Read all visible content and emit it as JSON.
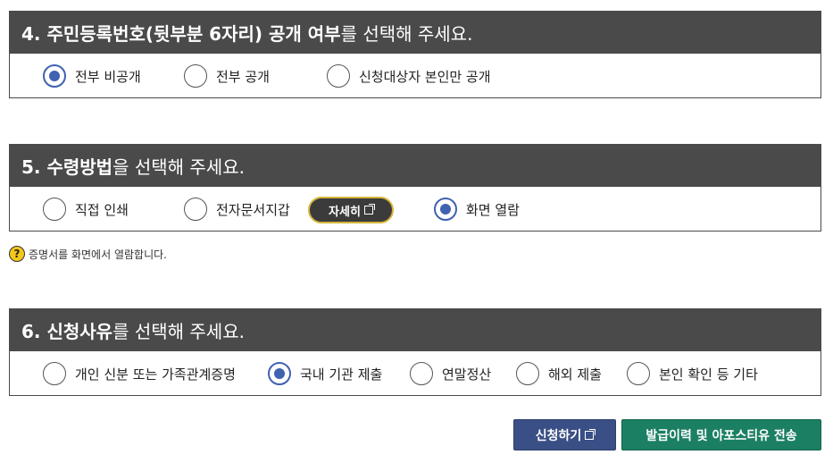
{
  "section4": {
    "title_strong": "4. 주민등록번호(뒷부분 6자리) 공개 여부",
    "title_rest": "를 선택해 주세요.",
    "options": [
      "전부 비공개",
      "전부 공개",
      "신청대상자 본인만 공개"
    ],
    "selected": "전부 비공개"
  },
  "section5": {
    "title_strong": "5. 수령방법",
    "title_rest": "을 선택해 주세요.",
    "options": [
      "직접 인쇄",
      "전자문서지갑",
      "화면 열람"
    ],
    "detail_button": "자세히",
    "selected": "화면 열람"
  },
  "note": {
    "icon": "?",
    "text": "증명서를 화면에서 열람합니다."
  },
  "section6": {
    "title_strong": "6. 신청사유",
    "title_rest": "를 선택해 주세요.",
    "options": [
      "개인 신분 또는 가족관계증명",
      "국내 기관 제출",
      "연말정산",
      "해외 제출",
      "본인 확인 등 기타"
    ],
    "selected": "국내 기관 제출"
  },
  "actions": {
    "apply": "신청하기",
    "history": "발급이력 및 아포스티유 전송"
  },
  "colors": {
    "header_bg": "#4a4a4a",
    "radio_selected": "#3f62b1",
    "apply_btn": "#3a4f86",
    "history_btn": "#1b7f63",
    "detail_border": "#d6b43a"
  }
}
